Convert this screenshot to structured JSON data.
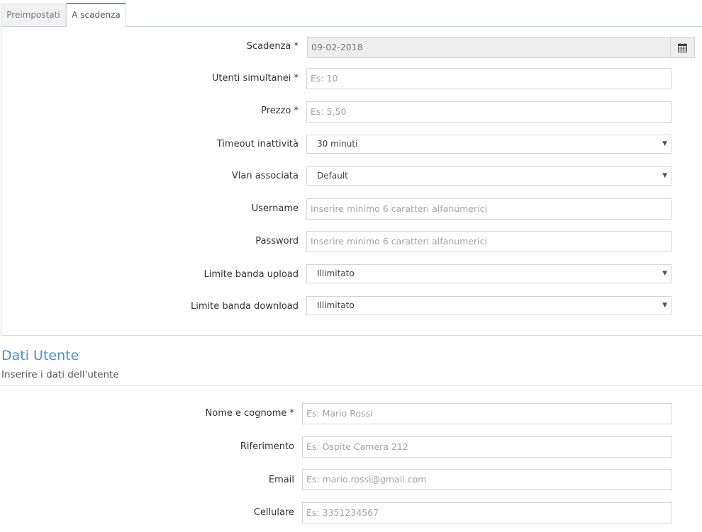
{
  "tabs": [
    {
      "label": "Preimpostati",
      "active": false
    },
    {
      "label": "A scadenza",
      "active": true
    }
  ],
  "expiry_form": {
    "scadenza": {
      "label": "Scadenza *",
      "value": "09-02-2018",
      "icon": "calendar-icon"
    },
    "utenti_simultanei": {
      "label": "Utenti simultanei *",
      "placeholder": "Es: 10"
    },
    "prezzo": {
      "label": "Prezzo *",
      "placeholder": "Es: 5,50"
    },
    "timeout": {
      "label": "Timeout inattività",
      "selected": "30 minuti"
    },
    "vlan": {
      "label": "Vlan associata",
      "selected": "Default"
    },
    "username": {
      "label": "Username",
      "placeholder": "Inserire minimo 6 caratteri alfanumerici"
    },
    "password": {
      "label": "Password",
      "placeholder": "Inserire minimo 6 caratteri alfanumerici"
    },
    "upload": {
      "label": "Limite banda upload",
      "selected": "Illimitato"
    },
    "download": {
      "label": "Limite banda download",
      "selected": "Illimitato"
    }
  },
  "user_section": {
    "title": "Dati Utente",
    "subtitle": "Inserire i dati dell'utente",
    "nome": {
      "label": "Nome e cognome *",
      "placeholder": "Es: Mario Rossi"
    },
    "riferimento": {
      "label": "Riferimento",
      "placeholder": "Es: Ospite Camera 212"
    },
    "email": {
      "label": "Email",
      "placeholder": "Es: mario.rossi@gmail.com"
    },
    "cellulare": {
      "label": "Cellulare",
      "placeholder": "Es: 3351234567"
    }
  },
  "colors": {
    "accent": "#478fca",
    "tab_active_border": "#5b9bd5"
  }
}
